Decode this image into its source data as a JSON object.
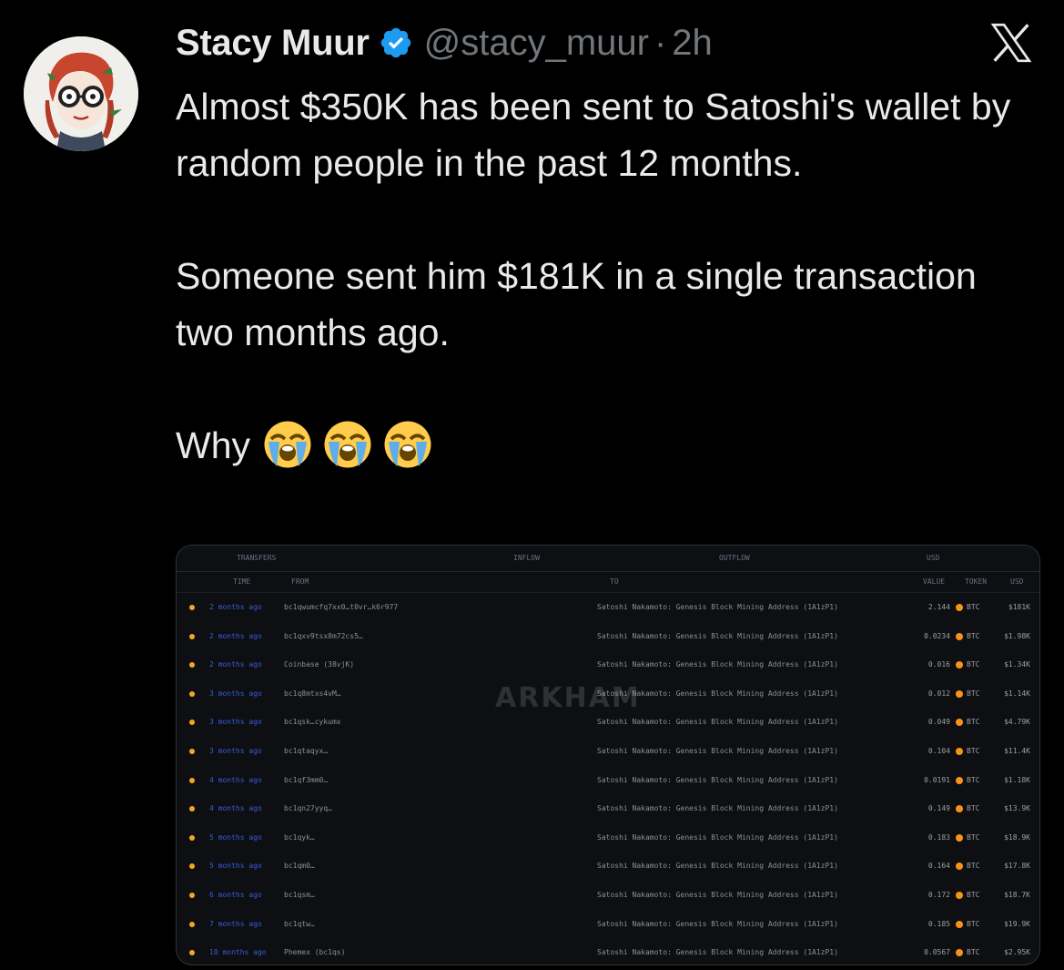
{
  "author": {
    "name": "Stacy Muur",
    "handle": "@stacy_muur",
    "separator": "·",
    "time": "2h"
  },
  "tweet": {
    "paragraphs": [
      "Almost $350K has been sent to Satoshi's wallet by random people in the past 12 months.",
      "Someone sent him $181K in a single transaction two months ago.",
      "Why"
    ],
    "emojis": [
      "loudly-crying-face-icon",
      "loudly-crying-face-icon",
      "loudly-crying-face-icon"
    ]
  },
  "colors": {
    "background": "#000000",
    "text": "#e7e9ea",
    "secondary": "#71767b",
    "verified": "#1d9bf0",
    "btc": "#f7931a"
  },
  "media": {
    "watermark": "ARKHAM",
    "header": {
      "transfers": "TRANSFERS",
      "inflow": "INFLOW",
      "outflow": "OUTFLOW",
      "usd": "USD"
    },
    "subheader": {
      "time": "TIME",
      "from": "FROM",
      "to": "TO",
      "value": "VALUE",
      "token": "TOKEN",
      "usd": "USD"
    },
    "rows": [
      {
        "ago": "2 months ago",
        "from": "bc1qwumcfq7xx0…t0vr…k6r977",
        "to": "Satoshi Nakamoto: Genesis Block Mining Address (1A1zP1)",
        "amount": "2.144",
        "token": "BTC",
        "usd": "$181K"
      },
      {
        "ago": "2 months ago",
        "from": "bc1qxv9tsx8m72cs5…",
        "to": "Satoshi Nakamoto: Genesis Block Mining Address (1A1zP1)",
        "amount": "0.0234",
        "token": "BTC",
        "usd": "$1.98K"
      },
      {
        "ago": "2 months ago",
        "from": "Coinbase (38vjK)",
        "to": "Satoshi Nakamoto: Genesis Block Mining Address (1A1zP1)",
        "amount": "0.016",
        "token": "BTC",
        "usd": "$1.34K"
      },
      {
        "ago": "3 months ago",
        "from": "bc1q8mtxs4vM…",
        "to": "Satoshi Nakamoto: Genesis Block Mining Address (1A1zP1)",
        "amount": "0.012",
        "token": "BTC",
        "usd": "$1.14K"
      },
      {
        "ago": "3 months ago",
        "from": "bc1qsk…cykumx",
        "to": "Satoshi Nakamoto: Genesis Block Mining Address (1A1zP1)",
        "amount": "0.049",
        "token": "BTC",
        "usd": "$4.79K"
      },
      {
        "ago": "3 months ago",
        "from": "bc1qtaqyx…",
        "to": "Satoshi Nakamoto: Genesis Block Mining Address (1A1zP1)",
        "amount": "0.104",
        "token": "BTC",
        "usd": "$11.4K"
      },
      {
        "ago": "4 months ago",
        "from": "bc1qf3mm0…",
        "to": "Satoshi Nakamoto: Genesis Block Mining Address (1A1zP1)",
        "amount": "0.0191",
        "token": "BTC",
        "usd": "$1.18K"
      },
      {
        "ago": "4 months ago",
        "from": "bc1qn27yyq…",
        "to": "Satoshi Nakamoto: Genesis Block Mining Address (1A1zP1)",
        "amount": "0.149",
        "token": "BTC",
        "usd": "$13.9K"
      },
      {
        "ago": "5 months ago",
        "from": "bc1qyk…",
        "to": "Satoshi Nakamoto: Genesis Block Mining Address (1A1zP1)",
        "amount": "0.183",
        "token": "BTC",
        "usd": "$18.9K"
      },
      {
        "ago": "5 months ago",
        "from": "bc1qm0…",
        "to": "Satoshi Nakamoto: Genesis Block Mining Address (1A1zP1)",
        "amount": "0.164",
        "token": "BTC",
        "usd": "$17.8K"
      },
      {
        "ago": "6 months ago",
        "from": "bc1qsm…",
        "to": "Satoshi Nakamoto: Genesis Block Mining Address (1A1zP1)",
        "amount": "0.172",
        "token": "BTC",
        "usd": "$18.7K"
      },
      {
        "ago": "7 months ago",
        "from": "bc1qtw…",
        "to": "Satoshi Nakamoto: Genesis Block Mining Address (1A1zP1)",
        "amount": "0.185",
        "token": "BTC",
        "usd": "$19.9K"
      },
      {
        "ago": "10 months ago",
        "from": "Phemex (bc1qs)",
        "to": "Satoshi Nakamoto: Genesis Block Mining Address (1A1zP1)",
        "amount": "0.0567",
        "token": "BTC",
        "usd": "$2.95K"
      }
    ]
  }
}
